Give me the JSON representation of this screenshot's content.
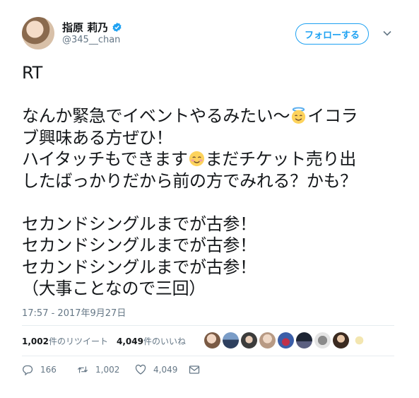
{
  "user": {
    "display_name": "指原 莉乃",
    "handle": "@345__chan"
  },
  "follow_button": {
    "label": "フォローする"
  },
  "tweet": {
    "line1": "RT",
    "line2": "なんか緊急でイベントやるみたい〜",
    "line2b": "イコラ",
    "line3": "ブ興味ある方ぜひ！",
    "line4": "ハイタッチもできます",
    "line4b": "まだチケット売り出",
    "line5": "したばっかりだから前の方でみれる？かも？",
    "line6": "セカンドシングルまでが古参！",
    "line7": "セカンドシングルまでが古参！",
    "line8": "セカンドシングルまでが古参！",
    "line9": "（大事ことなので三回）"
  },
  "timestamp": "17:57 - 2017年9月27日",
  "stats": {
    "retweets_count": "1,002",
    "retweets_label": "件のリツイート",
    "likes_count": "4,049",
    "likes_label": "件のいいね"
  },
  "actions": {
    "reply_count": "166",
    "retweet_count": "1,002",
    "like_count": "4,049"
  },
  "icons": {
    "verified": "verified-badge-icon",
    "caret": "chevron-down-icon",
    "emoji1": "smiling-face-with-halo-icon",
    "emoji2": "smiling-face-with-smiling-eyes-icon",
    "reply": "reply-icon",
    "retweet": "retweet-icon",
    "like": "heart-icon",
    "dm": "envelope-icon"
  },
  "colors": {
    "accent": "#1da1f2",
    "secondary_text": "#657786",
    "divider": "#e6ecf0"
  }
}
